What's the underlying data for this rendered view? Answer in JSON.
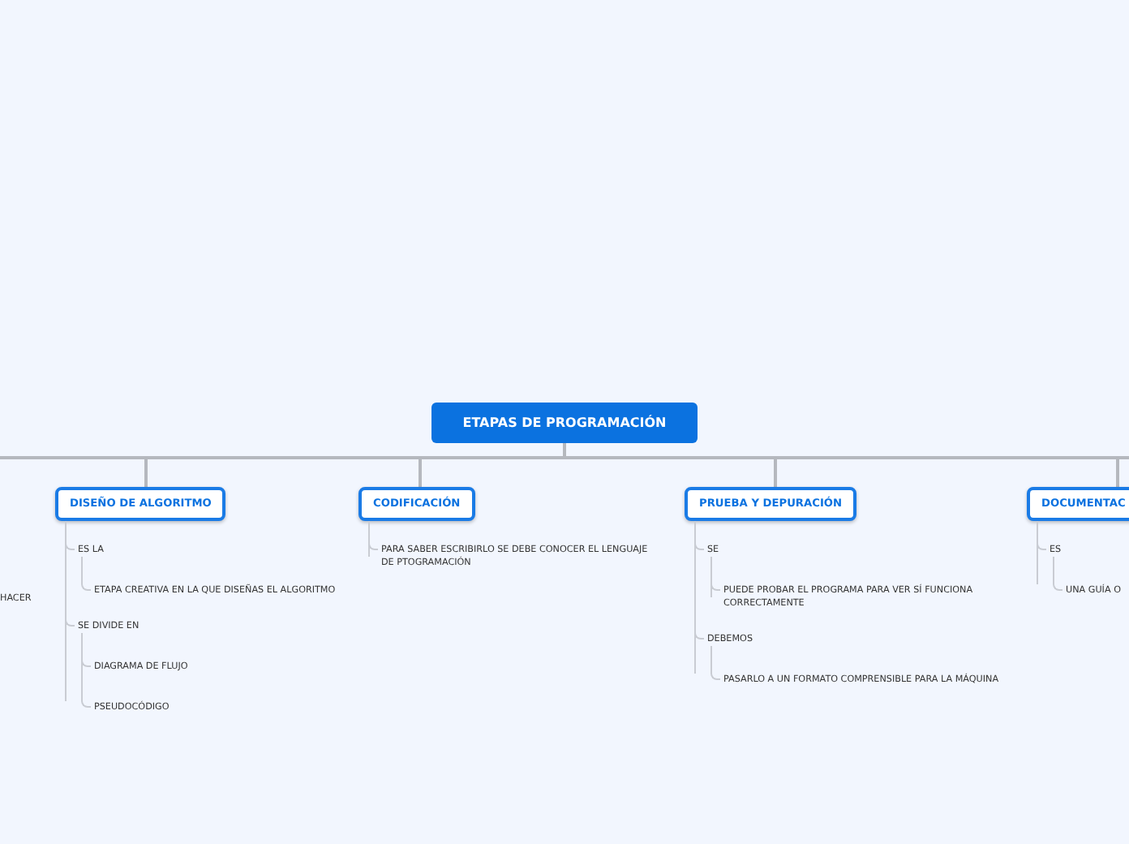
{
  "root": {
    "title": "ETAPAS DE PROGRAMACIÓN"
  },
  "cut_off_text": "HACER",
  "branches": [
    {
      "title": "DISEÑO DE ALGORITMO",
      "children": [
        {
          "text": "ES LA",
          "children": [
            {
              "text": "ETAPA CREATIVA EN LA QUE DISEÑAS EL ALGORITMO"
            }
          ]
        },
        {
          "text": "SE DIVIDE EN",
          "children": [
            {
              "text": "DIAGRAMA DE FLUJO"
            },
            {
              "text": "PSEUDOCÓDIGO"
            }
          ]
        }
      ]
    },
    {
      "title": "CODIFICACIÓN",
      "children": [
        {
          "text": "PARA SABER ESCRIBIRLO SE DEBE CONOCER EL LENGUAJE DE PTOGRAMACIÓN"
        }
      ]
    },
    {
      "title": "PRUEBA Y DEPURACIÓN",
      "children": [
        {
          "text": "SE",
          "children": [
            {
              "text": "PUEDE PROBAR EL PROGRAMA PARA VER SÍ FUNCIONA CORRECTAMENTE"
            }
          ]
        },
        {
          "text": "DEBEMOS",
          "children": [
            {
              "text": "PASARLO A UN FORMATO COMPRENSIBLE PARA LA MÁQUINA"
            }
          ]
        }
      ]
    },
    {
      "title": "DOCUMENTAC",
      "children": [
        {
          "text": "ES",
          "children": [
            {
              "text": "UNA GUÍA O"
            }
          ]
        }
      ]
    }
  ]
}
